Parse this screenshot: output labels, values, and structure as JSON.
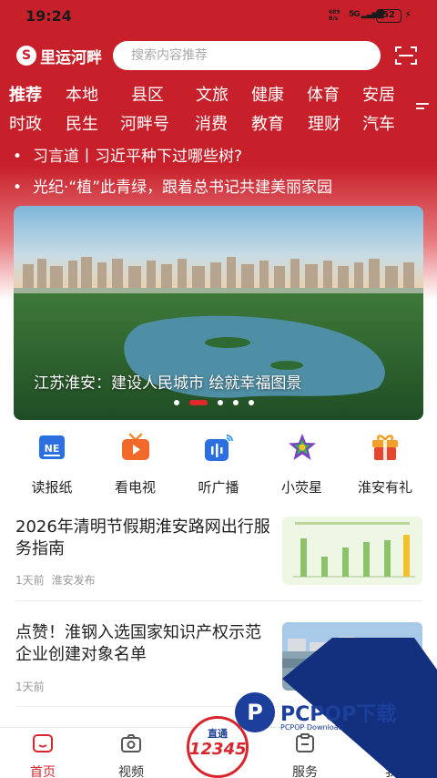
{
  "status": {
    "time": "19:24",
    "net_top": "689",
    "net_bottom": "B/s",
    "network": "5G",
    "battery": "52"
  },
  "header": {
    "app_name": "里运河畔",
    "search_placeholder": "搜索内容推荐"
  },
  "tabs": {
    "row1": [
      "推荐",
      "本地",
      "县区",
      "文旅",
      "健康",
      "体育",
      "安居"
    ],
    "row2": [
      "时政",
      "民生",
      "河畔号",
      "消费",
      "教育",
      "理财",
      "汽车"
    ]
  },
  "ticker": [
    "习言道丨习近平种下过哪些树?",
    "光纪·“植”此青绿，跟着总书记共建美丽家园"
  ],
  "banner": {
    "caption": "江苏淮安：建设人民城市 绘就幸福图景",
    "slide_count": 5,
    "active_slide": 1
  },
  "shortcuts": [
    {
      "label": "读报纸",
      "icon": "newspaper-icon"
    },
    {
      "label": "看电视",
      "icon": "tv-icon"
    },
    {
      "label": "听广播",
      "icon": "radio-icon"
    },
    {
      "label": "小荧星",
      "icon": "star-icon"
    },
    {
      "label": "淮安有礼",
      "icon": "gift-icon"
    }
  ],
  "news": [
    {
      "title": "2026年清明节假期淮安路网出行服务指南",
      "time": "1天前",
      "source": "淮安发布"
    },
    {
      "title": "点赞！淮钢入选国家知识产权示范企业创建对象名单",
      "time": "1天前",
      "source": ""
    }
  ],
  "bottom_nav": {
    "home": "首页",
    "video": "视频",
    "hotline_top": "直通",
    "hotline_number": "12345",
    "service": "服务",
    "mine": "我"
  },
  "watermark": {
    "brand": "PCPOP下载",
    "sub": "PCPOP Download"
  },
  "colors": {
    "brand_red": "#c8202a",
    "accent_red": "#d8252d",
    "watermark_blue": "#1b3f9a"
  }
}
